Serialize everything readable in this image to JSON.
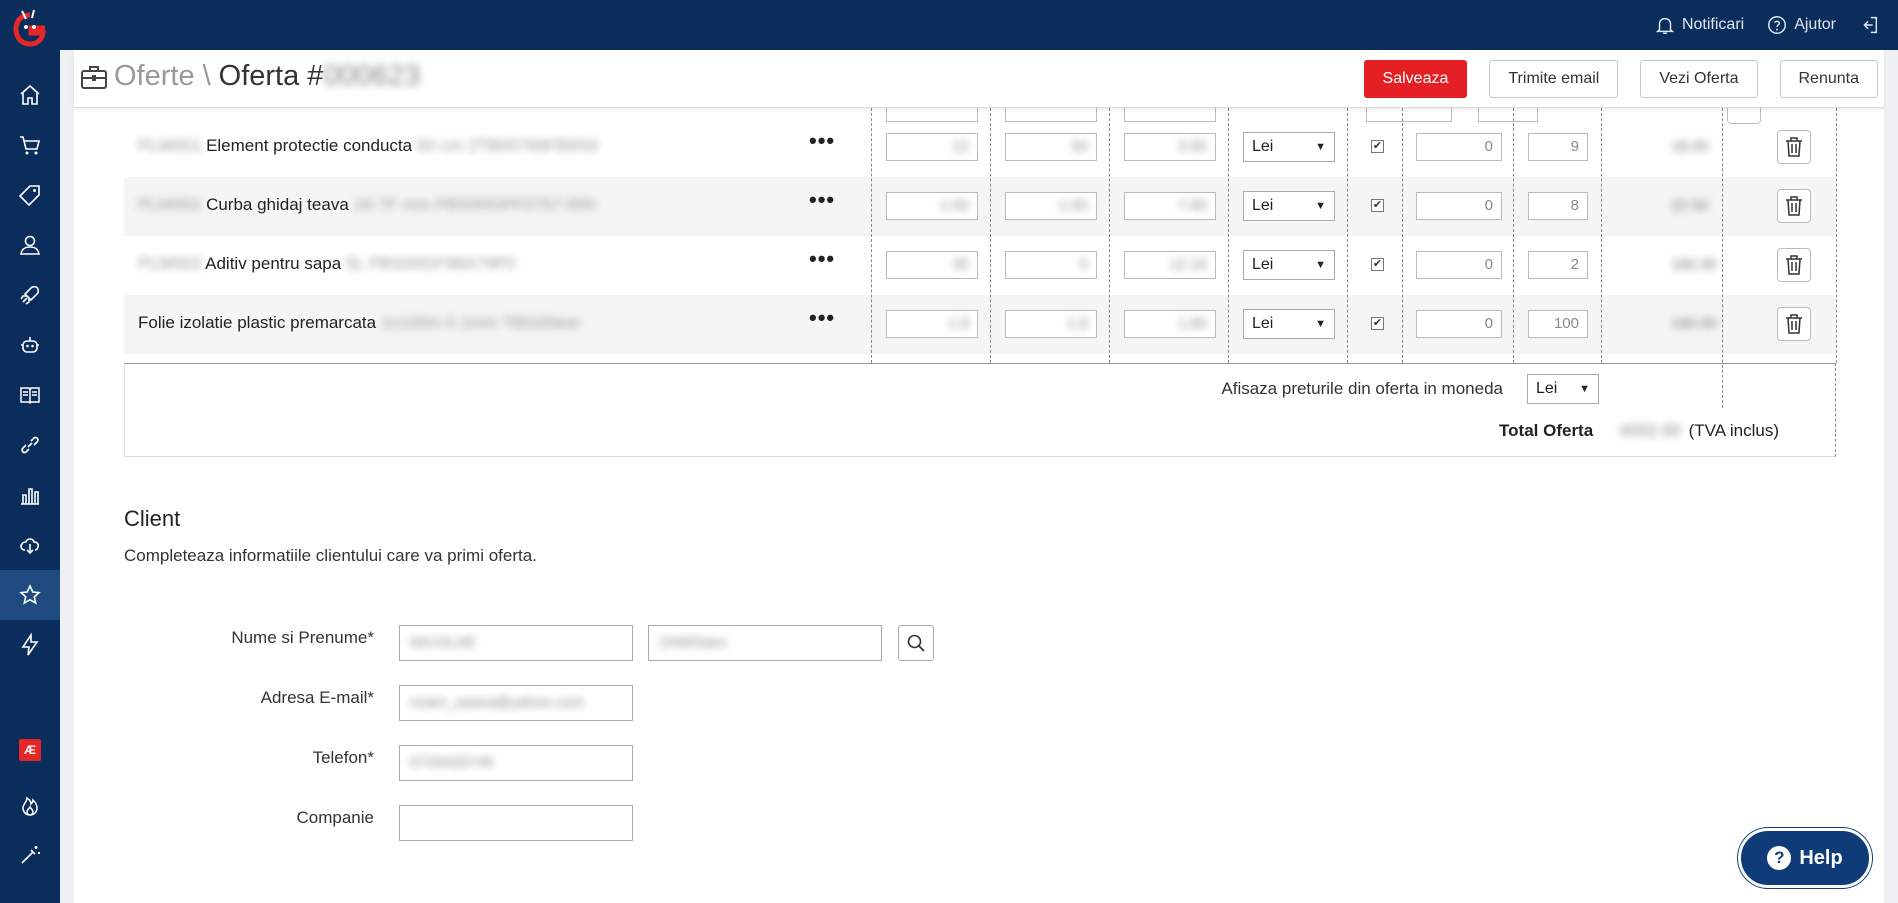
{
  "topbar": {
    "notifications_label": "Notificari",
    "help_label": "Ajutor"
  },
  "header": {
    "breadcrumb_parent": "Oferte",
    "separator": "\\",
    "breadcrumb_current": "Oferta #",
    "offer_number": "000623",
    "buttons": {
      "save": "Salveaza",
      "send_email": "Trimite email",
      "view_offer": "Vezi Oferta",
      "cancel": "Renunta"
    }
  },
  "products": [
    {
      "code": "PLM001",
      "name": "Element protectie conducta",
      "desc": "50 cm 2TB00789FB9S0",
      "v1": "12",
      "v2": "50",
      "v3": "3.50",
      "currency": "Lei",
      "checked": true,
      "discount": "0",
      "qty": "9",
      "total": "18.00"
    },
    {
      "code": "PLM002",
      "name": "Curba ghidaj teava",
      "desc": "16-7F mm PBS00GPF0757-000",
      "v1": "1.50",
      "v2": "1.50",
      "v3": "7.80",
      "currency": "Lei",
      "checked": true,
      "discount": "0",
      "qty": "8",
      "total": "22.50"
    },
    {
      "code": "PLM003",
      "name": "Aditiv pentru sapa",
      "desc": "5L PBS00GF98A79P0",
      "v1": "35",
      "v2": "5",
      "v3": "12.10",
      "currency": "Lei",
      "checked": true,
      "discount": "0",
      "qty": "2",
      "total": "180.00"
    },
    {
      "code": "",
      "name": "Folie izolatie plastic premarcata",
      "desc": "1x100m 0.1mm TBG00eer",
      "v1": "1.8",
      "v2": "1.8",
      "v3": "1.80",
      "currency": "Lei",
      "checked": true,
      "discount": "0",
      "qty": "100",
      "total": "180.00"
    }
  ],
  "summary": {
    "currency_label": "Afisaza preturile din oferta in moneda",
    "currency_value": "Lei",
    "total_label": "Total Oferta",
    "total_value": "4002.00",
    "vat_note": "(TVA inclus)"
  },
  "client": {
    "title": "Client",
    "description": "Completeaza informatiile clientului care va primi oferta.",
    "name_label": "Nume si Prenume*",
    "first_name": "NICOLAE",
    "last_name": "ZAMISaru",
    "email_label": "Adresa E-mail*",
    "email": "nzam_sasea@yahoo.com",
    "phone_label": "Telefon*",
    "phone": "0726425745",
    "company_label": "Companie",
    "company": ""
  },
  "help_button": "Help",
  "sidebar_badge": "Æ",
  "colors": {
    "navy": "#0b2d5b",
    "primary_red": "#e42025",
    "help_blue": "#0f3b78"
  },
  "icons": [
    "home-icon",
    "cart-icon",
    "tag-icon",
    "users-icon",
    "rocket-icon",
    "robot-icon",
    "book-icon",
    "link-icon",
    "chart-icon",
    "cloud-download-icon",
    "star-icon",
    "bolt-icon",
    "flame-icon",
    "magic-wand-icon"
  ]
}
